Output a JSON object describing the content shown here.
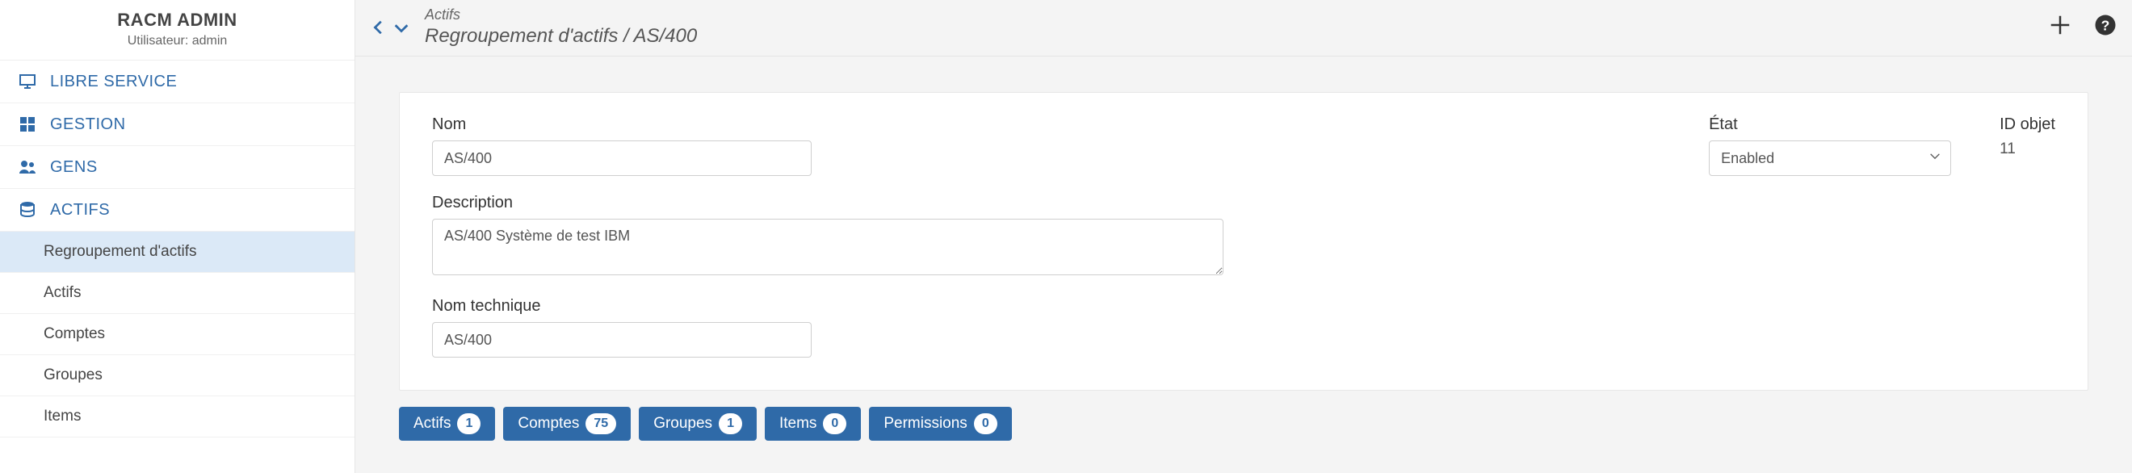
{
  "sidebar": {
    "title": "RACM ADMIN",
    "user_prefix": "Utilisateur:",
    "user_name": "admin",
    "nav": [
      {
        "label": "LIBRE SERVICE",
        "icon": "monitor"
      },
      {
        "label": "GESTION",
        "icon": "dashboard"
      },
      {
        "label": "GENS",
        "icon": "people"
      },
      {
        "label": "ACTIFS",
        "icon": "database"
      }
    ],
    "sub_nav": [
      {
        "label": "Regroupement d'actifs",
        "selected": true
      },
      {
        "label": "Actifs"
      },
      {
        "label": "Comptes"
      },
      {
        "label": "Groupes"
      },
      {
        "label": "Items"
      }
    ]
  },
  "topbar": {
    "crumb_top": "Actifs",
    "crumb_main": "Regroupement d'actifs / AS/400"
  },
  "form": {
    "name_label": "Nom",
    "name_value": "AS/400",
    "desc_label": "Description",
    "desc_value": "AS/400 Système de test IBM",
    "tech_label": "Nom technique",
    "tech_value": "AS/400",
    "state_label": "État",
    "state_value": "Enabled",
    "objid_label": "ID objet",
    "objid_value": "11"
  },
  "tabs": [
    {
      "label": "Actifs",
      "count": "1"
    },
    {
      "label": "Comptes",
      "count": "75"
    },
    {
      "label": "Groupes",
      "count": "1"
    },
    {
      "label": "Items",
      "count": "0"
    },
    {
      "label": "Permissions",
      "count": "0"
    }
  ]
}
